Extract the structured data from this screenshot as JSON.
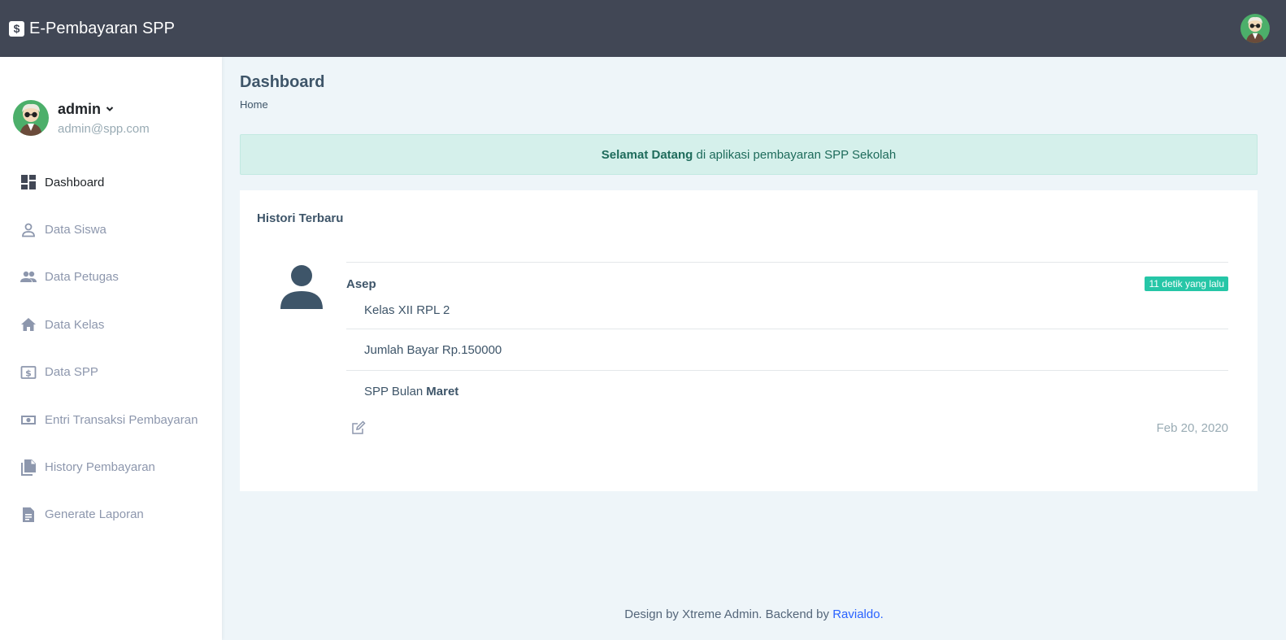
{
  "topbar": {
    "brand_icon": "$",
    "brand_title": "E-Pembayaran SPP",
    "avatar_icon": "user-avatar-icon"
  },
  "sidebar": {
    "profile": {
      "name": "admin",
      "email": "admin@spp.com"
    },
    "items": [
      {
        "label": "Dashboard",
        "icon": "dashboard-icon",
        "active": true
      },
      {
        "label": "Data Siswa",
        "icon": "person-icon"
      },
      {
        "label": "Data Petugas",
        "icon": "people-icon"
      },
      {
        "label": "Data Kelas",
        "icon": "home-icon"
      },
      {
        "label": "Data SPP",
        "icon": "dollar-box-icon"
      },
      {
        "label": "Entri Transaksi Pembayaran",
        "icon": "cash-icon"
      },
      {
        "label": "History Pembayaran",
        "icon": "file-multiple-icon"
      },
      {
        "label": "Generate Laporan",
        "icon": "file-document-icon"
      }
    ]
  },
  "main": {
    "title": "Dashboard",
    "breadcrumb": "Home",
    "alert": {
      "strong": "Selamat Datang",
      "text": " di aplikasi pembayaran SPP Sekolah"
    },
    "history": {
      "title": "Histori Terbaru",
      "name": "Asep",
      "badge": "11 detik yang lalu",
      "kelas": "Kelas XII RPL 2",
      "jumlah": "Jumlah Bayar Rp.150000",
      "spp_prefix": "SPP Bulan",
      "spp_month": "Maret",
      "date": "Feb 20, 2020"
    }
  },
  "footer": {
    "text": "Design by Xtreme Admin. Backend by ",
    "link": "Ravialdo",
    "suffix": "."
  },
  "colors": {
    "topbar": "#414755",
    "badge": "#26c6a7",
    "alert_bg": "#d5f0eb",
    "link": "#2962ff"
  }
}
